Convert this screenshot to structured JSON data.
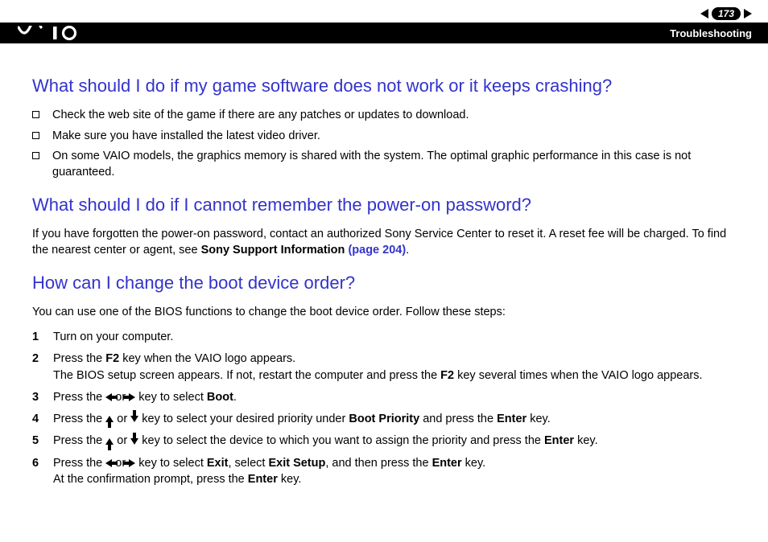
{
  "header": {
    "page_number": "173",
    "section": "Troubleshooting"
  },
  "q1": {
    "heading": "What should I do if my game software does not work or it keeps crashing?",
    "bullets": [
      "Check the web site of the game if there are any patches or updates to download.",
      "Make sure you have installed the latest video driver.",
      "On some VAIO models, the graphics memory is shared with the system. The optimal graphic performance in this case is not guaranteed."
    ]
  },
  "q2": {
    "heading": "What should I do if I cannot remember the power-on password?",
    "para_a": "If you have forgotten the power-on password, contact an authorized Sony Service Center to reset it. A reset fee will be charged. To find the nearest center or agent, see ",
    "link_bold": "Sony Support Information ",
    "link_page": "(page 204)",
    "para_end": "."
  },
  "q3": {
    "heading": "How can I change the boot device order?",
    "intro": "You can use one of the BIOS functions to change the boot device order. Follow these steps:",
    "steps": {
      "s1": {
        "n": "1",
        "text": "Turn on your computer."
      },
      "s2": {
        "n": "2",
        "a": "Press the ",
        "f2": "F2",
        "b": " key when the VAIO logo appears.",
        "c": "The BIOS setup screen appears. If not, restart the computer and press the ",
        "d": " key several times when the VAIO logo appears."
      },
      "s3": {
        "n": "3",
        "a": "Press the ",
        "or": " or ",
        "b": " key to select ",
        "boot": "Boot",
        "end": "."
      },
      "s4": {
        "n": "4",
        "a": "Press the ",
        "or": " or ",
        "b": " key to select your desired priority under ",
        "bp": "Boot Priority",
        "c": " and press the ",
        "enter": "Enter",
        "end": " key."
      },
      "s5": {
        "n": "5",
        "a": "Press the ",
        "or": " or ",
        "b": " key to select the device to which you want to assign the priority and press the ",
        "enter": "Enter",
        "end": " key."
      },
      "s6": {
        "n": "6",
        "a": "Press the ",
        "or": " or ",
        "b": " key to select ",
        "exit": "Exit",
        "c": ", select ",
        "exitsetup": "Exit Setup",
        "d": ", and then press the ",
        "enter": "Enter",
        "e": " key.",
        "f": "At the confirmation prompt, press the ",
        "g": " key."
      }
    }
  }
}
